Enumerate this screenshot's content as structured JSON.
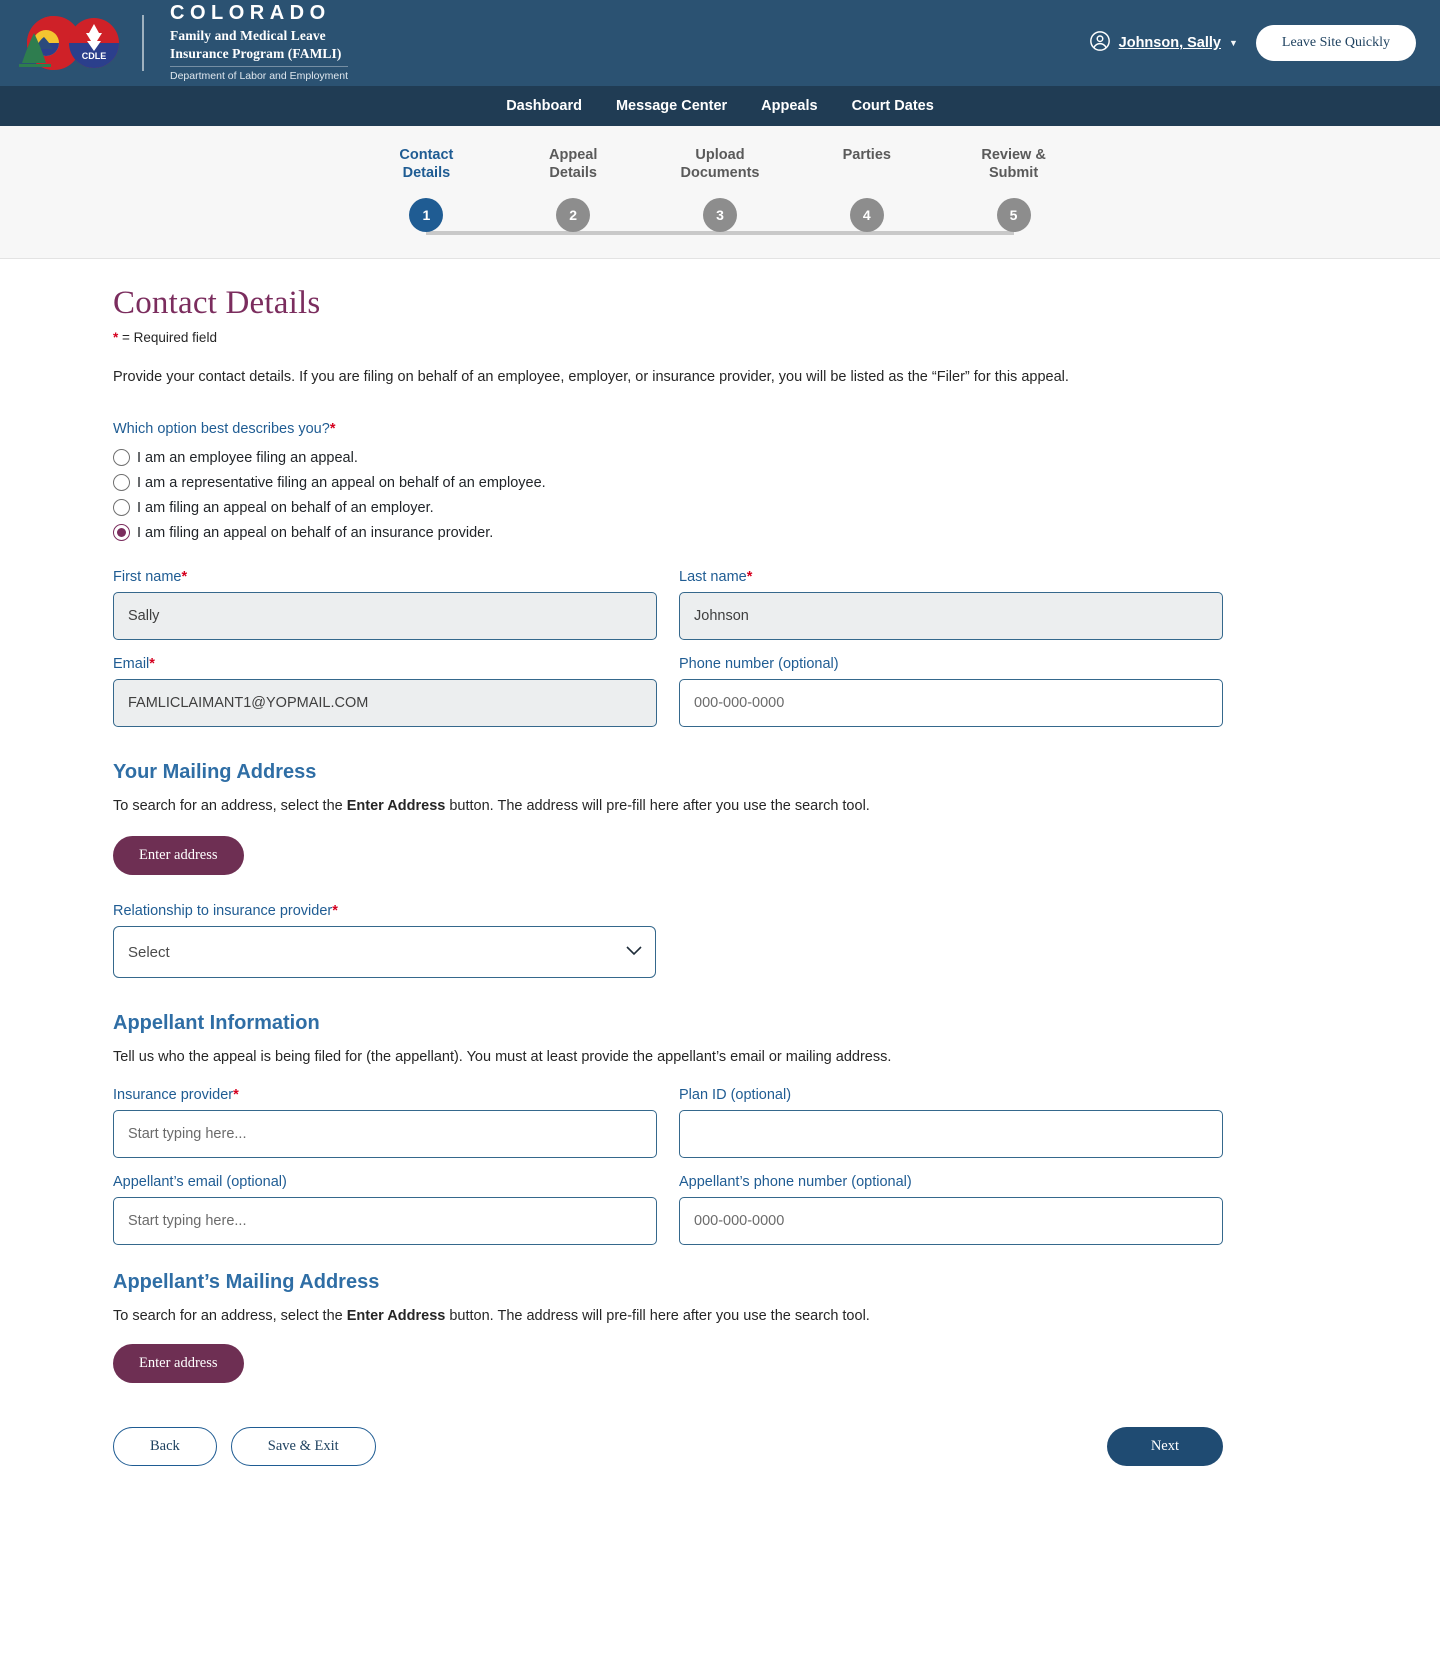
{
  "colors": {
    "masthead_bg": "#2b5272",
    "nav_bg": "#203c54",
    "accent_purple": "#7b2d5e",
    "accent_blue": "#1f5c93",
    "required_red": "#d5001f",
    "step_inactive": "#8d8d8d"
  },
  "masthead": {
    "logo_icon": "colorado-cdle-logo",
    "state_name": "COLORADO",
    "program_line1": "Family and Medical Leave",
    "program_line2": "Insurance Program (FAMLI)",
    "department": "Department of Labor and Employment",
    "user_icon": "user-circle-icon",
    "user_name": "Johnson, Sally",
    "caret_icon": "chevron-down-icon",
    "leave_button": "Leave Site Quickly"
  },
  "nav": {
    "items": [
      {
        "label": "Dashboard"
      },
      {
        "label": "Message Center"
      },
      {
        "label": "Appeals"
      },
      {
        "label": "Court Dates"
      }
    ]
  },
  "stepper": {
    "active_index": 0,
    "steps": [
      {
        "number": "1",
        "label": "Contact\nDetails"
      },
      {
        "number": "2",
        "label": "Appeal\nDetails"
      },
      {
        "number": "3",
        "label": "Upload\nDocuments"
      },
      {
        "number": "4",
        "label": "Parties"
      },
      {
        "number": "5",
        "label": "Review &\nSubmit"
      }
    ]
  },
  "page": {
    "title": "Contact Details",
    "required_star": "*",
    "required_note": " = Required field",
    "intro": "Provide your contact details. If you are filing on behalf of an employee, employer, or insurance provider, you will be listed as the “Filer” for this appeal."
  },
  "describe_you": {
    "legend": "Which option best describes you?",
    "options": [
      {
        "label": "I am an employee filing an appeal.",
        "checked": false
      },
      {
        "label": "I am a representative filing an appeal on behalf of an employee.",
        "checked": false
      },
      {
        "label": "I am filing an appeal on behalf of an employer.",
        "checked": false
      },
      {
        "label": "I am filing an appeal on behalf of an insurance provider.",
        "checked": true
      }
    ]
  },
  "filer": {
    "first_name_label": "First name",
    "first_name_value": "Sally",
    "last_name_label": "Last name",
    "last_name_value": "Johnson",
    "email_label": "Email",
    "email_value": "FAMLICLAIMANT1@YOPMAIL.COM",
    "phone_label": "Phone number (optional)",
    "phone_placeholder": "000-000-0000",
    "phone_value": ""
  },
  "your_address": {
    "heading": "Your Mailing Address",
    "helper_pre": "To search for an address, select the ",
    "helper_bold": "Enter Address",
    "helper_post": " button. The address will pre-fill here after you use the search tool.",
    "button": "Enter address"
  },
  "relationship": {
    "label": "Relationship to insurance provider",
    "selected": "Select",
    "options": [
      "Select"
    ],
    "chevron_icon": "chevron-down-icon"
  },
  "appellant": {
    "heading": "Appellant Information",
    "helper": "Tell us who the appeal is being filed for (the appellant). You must at least provide the appellant’s email or mailing address.",
    "insurance_provider_label": "Insurance provider",
    "insurance_provider_placeholder": "Start typing here...",
    "insurance_provider_value": "",
    "plan_id_label": "Plan ID (optional)",
    "plan_id_placeholder": "",
    "plan_id_value": "",
    "email_label": "Appellant’s email (optional)",
    "email_placeholder": "Start typing here...",
    "email_value": "",
    "phone_label": "Appellant’s phone number (optional)",
    "phone_placeholder": "000-000-0000",
    "phone_value": ""
  },
  "appellant_address": {
    "heading": "Appellant’s Mailing Address",
    "helper_pre": "To search for an address, select the ",
    "helper_bold": "Enter Address",
    "helper_post": " button. The address will pre-fill here after you use the search tool.",
    "button": "Enter address"
  },
  "footer": {
    "back": "Back",
    "save_exit": "Save & Exit",
    "next": "Next"
  }
}
